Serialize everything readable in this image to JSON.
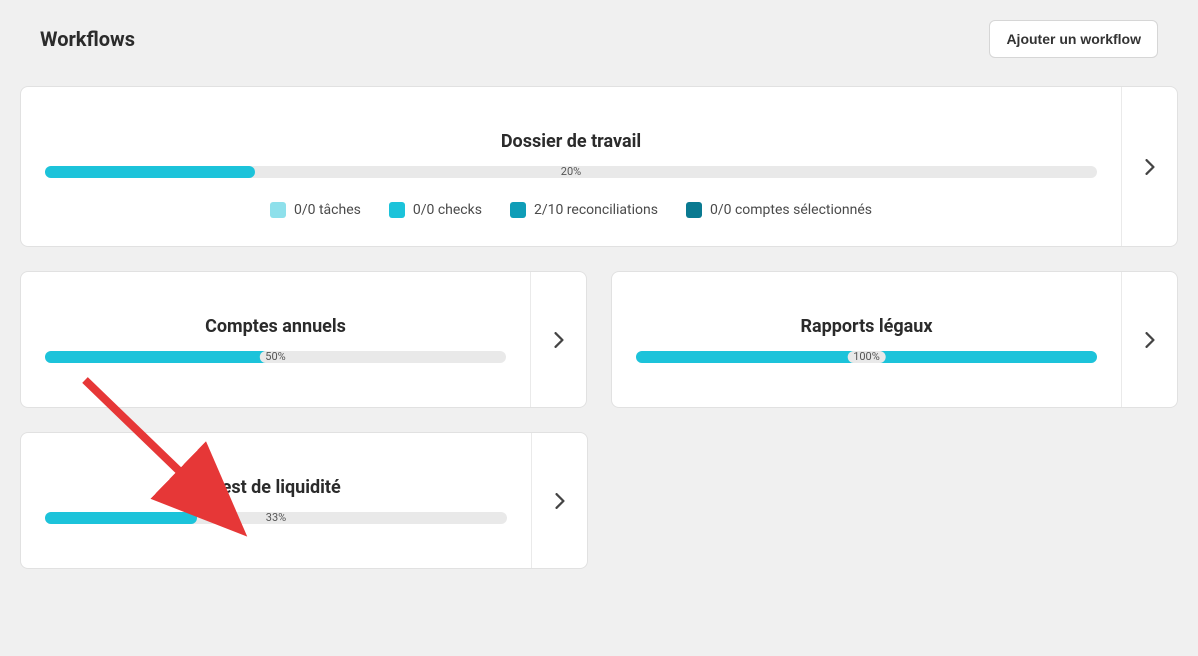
{
  "header": {
    "title": "Workflows",
    "add_label": "Ajouter un workflow"
  },
  "main_card": {
    "title": "Dossier de travail",
    "percent": 20,
    "percent_text": "20%",
    "legend": [
      {
        "text": "0/0 tâches"
      },
      {
        "text": "0/0 checks"
      },
      {
        "text": "2/10 reconciliations"
      },
      {
        "text": "0/0 comptes sélectionnés"
      }
    ]
  },
  "cards": [
    {
      "title": "Comptes annuels",
      "percent": 50,
      "percent_text": "50%"
    },
    {
      "title": "Rapports légaux",
      "percent": 100,
      "percent_text": "100%"
    },
    {
      "title": "Test de liquidité",
      "percent": 33,
      "percent_text": "33%"
    }
  ]
}
